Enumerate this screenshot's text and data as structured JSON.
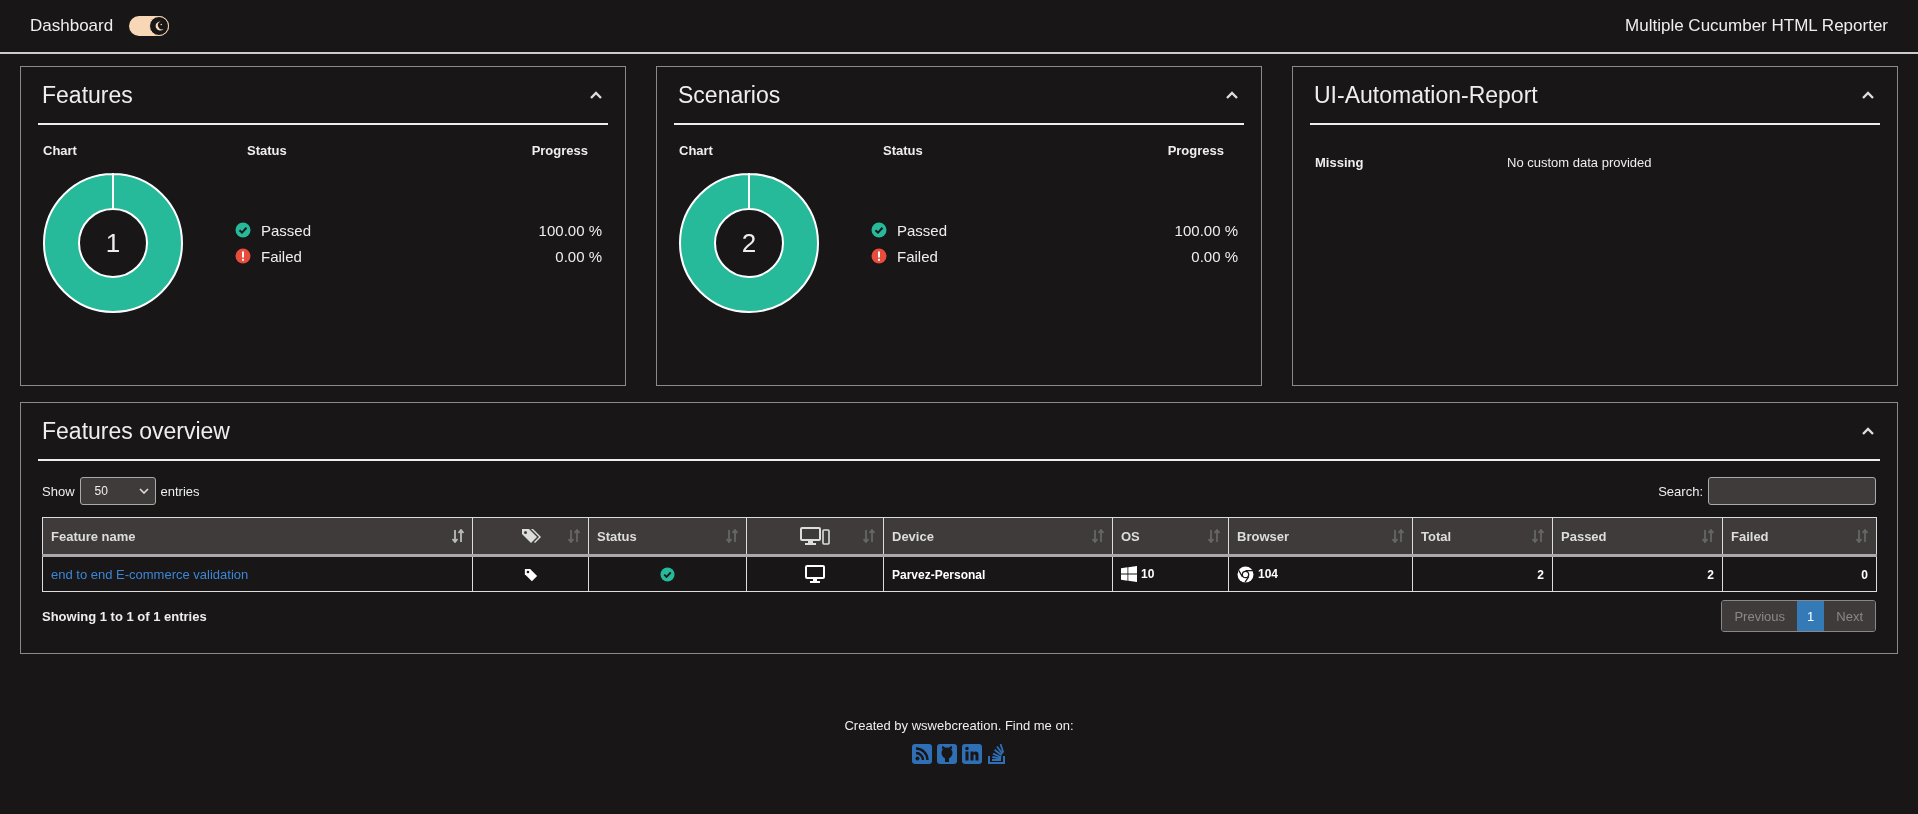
{
  "header": {
    "title": "Dashboard",
    "theme_toggle": {
      "on": true
    },
    "brand": "Multiple Cucumber HTML Reporter"
  },
  "summary_panels": [
    {
      "kind": "chart",
      "title": "Features",
      "expanded": true,
      "columns": [
        "Chart",
        "Status",
        "Progress"
      ],
      "total": "1",
      "statuses": [
        {
          "kind": "passed",
          "label": "Passed",
          "color": "#26b99a",
          "progress": "100.00 %"
        },
        {
          "kind": "failed",
          "label": "Failed",
          "color": "#e74c3c",
          "progress": "0.00 %"
        }
      ]
    },
    {
      "kind": "chart",
      "title": "Scenarios",
      "expanded": true,
      "columns": [
        "Chart",
        "Status",
        "Progress"
      ],
      "total": "2",
      "statuses": [
        {
          "kind": "passed",
          "label": "Passed",
          "color": "#26b99a",
          "progress": "100.00 %"
        },
        {
          "kind": "failed",
          "label": "Failed",
          "color": "#e74c3c",
          "progress": "0.00 %"
        }
      ]
    },
    {
      "kind": "metadata",
      "title": "UI-Automation-Report",
      "expanded": true,
      "entries": [
        {
          "key": "Missing",
          "value": "No custom data provided"
        }
      ]
    }
  ],
  "overview": {
    "title": "Features overview",
    "expanded": true,
    "show_label": "Show",
    "page_size": "50",
    "entries_label": "entries",
    "search_label": "Search:",
    "columns": [
      {
        "kind": "text",
        "label": "Feature name",
        "sorted": true
      },
      {
        "kind": "tags",
        "sorted": false
      },
      {
        "kind": "text",
        "label": "Status",
        "sorted": false
      },
      {
        "kind": "devices",
        "sorted": false
      },
      {
        "kind": "text",
        "label": "Device",
        "sorted": false
      },
      {
        "kind": "text",
        "label": "OS",
        "sorted": false
      },
      {
        "kind": "text",
        "label": "Browser",
        "sorted": false
      },
      {
        "kind": "text",
        "label": "Total",
        "sorted": false
      },
      {
        "kind": "text",
        "label": "Passed",
        "sorted": false
      },
      {
        "kind": "text",
        "label": "Failed",
        "sorted": false
      }
    ],
    "rows": [
      {
        "feature": "end to end E-commerce validation",
        "status_ok": true,
        "device": {
          "kind": "desktop",
          "name": "Parvez-Personal"
        },
        "os": {
          "kind": "windows",
          "version": "10"
        },
        "browser": {
          "kind": "chrome",
          "version": "104"
        },
        "total": "2",
        "passed": "2",
        "failed": "0"
      }
    ],
    "info": "Showing 1 to 1 of 1 entries",
    "pagination": [
      {
        "kind": "previous",
        "label": "Previous",
        "disabled": true,
        "selected": false
      },
      {
        "kind": "page",
        "label": "1",
        "disabled": false,
        "selected": true
      },
      {
        "kind": "next",
        "label": "Next",
        "disabled": true,
        "selected": false
      }
    ]
  },
  "footer": {
    "text": "Created by wswebcreation. Find me on:"
  }
}
